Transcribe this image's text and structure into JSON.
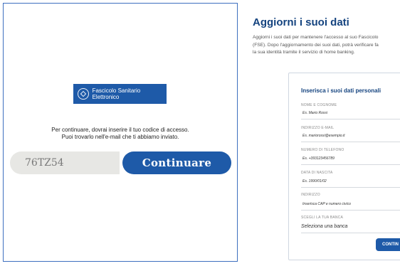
{
  "login": {
    "logo_text": "Fascicolo Sanitario Elettronico",
    "instructions_line1": "Per continuare, dovrai inserire il tuo codice di accesso.",
    "instructions_line2": "Puoi trovarlo nell'e-mail che ti abbiamo inviato.",
    "code_value": "76TZ54",
    "continue_label": "Continuare"
  },
  "update": {
    "title": "Aggiorni i suoi dati",
    "description_lines": [
      "Aggiorni i suoi dati per mantenere l'accesso al suo Fascicolo",
      "(FSE). Dopo l'aggiornamento dei suoi dati, potrà verificare fa",
      "la sua identità tramite il servizio di home banking."
    ],
    "form": {
      "title": "Inserisca i suoi dati personali",
      "fields": [
        {
          "label": "NOME E COGNOME",
          "placeholder": "Es. Mario Rossi"
        },
        {
          "label": "INDIRIZZO E-MAIL",
          "placeholder": "Es. mariorossi@esempio.it"
        },
        {
          "label": "NUMERO DI TELEFONO",
          "placeholder": "Es. +393123456789"
        },
        {
          "label": "DATA DI NASCITA",
          "placeholder": "Es. 1990/01/02"
        },
        {
          "label": "INDIRIZZO",
          "placeholder": "Inserisca CAP e numero civico"
        }
      ],
      "bank_label": "SCEGLI LA TUA BANCA",
      "bank_value": "Seleziona una banca",
      "submit_label": "CONTIN"
    }
  },
  "colors": {
    "brand_blue": "#1e5aa8",
    "title_blue": "#14437f",
    "frame_border": "#3d6fbf",
    "input_bg": "#e7e7e4"
  }
}
